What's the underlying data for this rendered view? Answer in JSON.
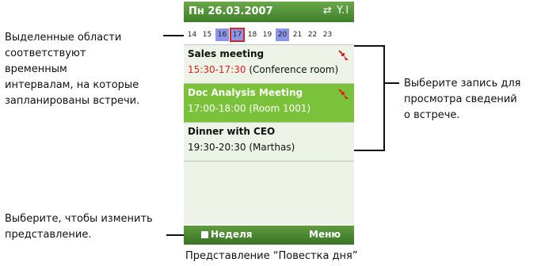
{
  "callouts": {
    "highlighted": [
      "Выделенные области",
      "соответствуют",
      "временным",
      "интервалам, на которые",
      "запланированы встречи."
    ],
    "select_entry": [
      "Выберите запись для",
      "просмотра сведений",
      "о встрече."
    ],
    "change_view": [
      "Выберите, чтобы изменить",
      "представление."
    ]
  },
  "phone": {
    "date": "Пн 26.03.2007",
    "status_icons": "⇄ Y.l",
    "days": [
      {
        "label": "14",
        "busy": false
      },
      {
        "label": "15",
        "busy": false
      },
      {
        "label": "16",
        "busy": true
      },
      {
        "label": "17",
        "busy": true,
        "today": true
      },
      {
        "label": "18",
        "busy": false
      },
      {
        "label": "19",
        "busy": false
      },
      {
        "label": "20",
        "busy": true
      },
      {
        "label": "21",
        "busy": false
      },
      {
        "label": "22",
        "busy": false
      },
      {
        "label": "23",
        "busy": false
      }
    ],
    "appointments": [
      {
        "title": "Sales meeting",
        "time": "15:30-17:30",
        "place": "(Conference room)",
        "time_color": "#e02020",
        "selected": false,
        "flag": true
      },
      {
        "title": "Doc Analysis Meeting",
        "time": "17:00-18:00",
        "place": "(Room 1001)",
        "time_color": "#ffffff",
        "selected": true,
        "flag": true
      },
      {
        "title": "Dinner with CEO",
        "time": "19:30-20:30",
        "place": "(Marthas)",
        "time_color": "#111111",
        "selected": false,
        "flag": false
      }
    ],
    "softkeys": {
      "left": "Неделя",
      "right": "Меню"
    }
  },
  "caption": "Представление “Повестка дня”",
  "colors": {
    "accent_green": "#79c23a",
    "busy_blue": "#8d96e6",
    "flag_red": "#e02020"
  }
}
